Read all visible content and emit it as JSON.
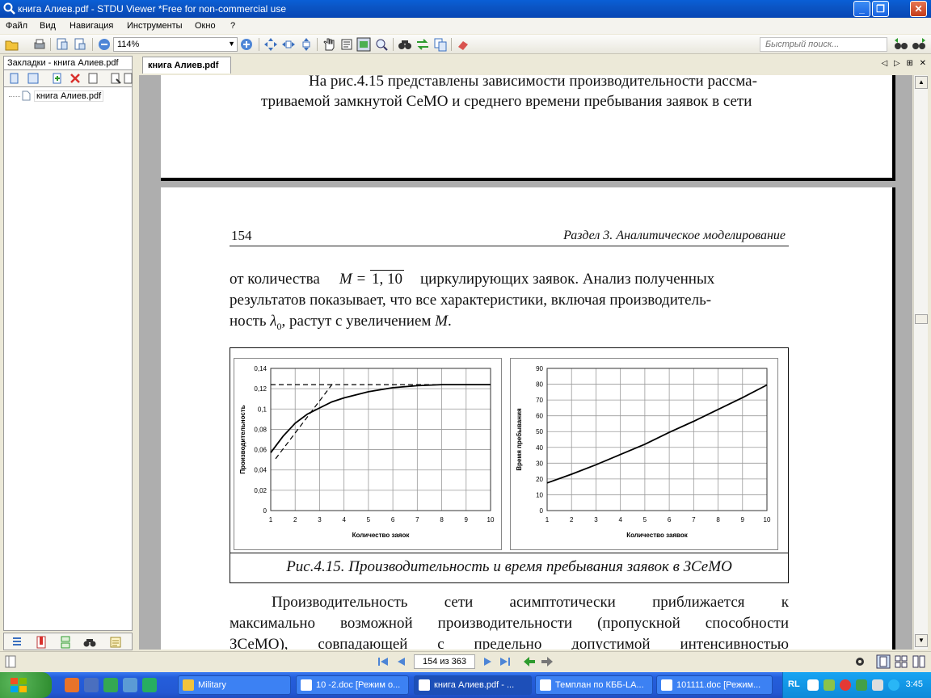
{
  "window": {
    "title": "книга Алиев.pdf - STDU Viewer *Free for non-commercial use",
    "min": "_",
    "max": "❐",
    "close": "✕"
  },
  "menu": [
    "Файл",
    "Вид",
    "Навигация",
    "Инструменты",
    "Окно",
    "?"
  ],
  "toolbar": {
    "zoom": "114%",
    "quick_search_placeholder": "Быстрый поиск..."
  },
  "bookmarks": {
    "tab_label": "Закладки - книга Алиев.pdf",
    "tree": [
      {
        "label": "книга Алиев.pdf"
      }
    ]
  },
  "doc_tab": {
    "label": "книга Алиев.pdf",
    "controls": [
      "◁",
      "▷",
      "⊞",
      "✕"
    ]
  },
  "page_prev": {
    "line1": "На рис.4.15 представлены зависимости производительности рассма-",
    "line2": "триваемой замкнутой СеМО и среднего времени пребывания заявок в сети"
  },
  "page": {
    "number": "154",
    "section": "Раздел 3.",
    "section_title": " Аналитическое моделирование",
    "para1": {
      "l1a": "от количества",
      "m_eq": "M = ",
      "range": "1, 10",
      "l1b": "циркулирующих заявок. Анализ полученных",
      "l2": "результатов показывает, что все характеристики, включая производитель-",
      "l3a": "ность ",
      "lambda": "λ",
      "sub0": "0",
      "l3b": ", растут с увеличением ",
      "M": "M",
      "dot": "."
    },
    "caption": "Рис.4.15. Производительность и время пребывания заявок в ЗСеМО",
    "para2": {
      "l1": "Производительность   сети   асимптотически   приближается   к",
      "l2": "максимально возможной производительности (пропускной способности",
      "l3": "ЗСеМО),   совпадающей   с   предельно   допустимой   интенсивностью"
    }
  },
  "chart_data": [
    {
      "type": "line",
      "xlabel": "Количество заяок",
      "ylabel": "Производительность",
      "xlim": [
        1,
        10
      ],
      "ylim": [
        0,
        0.14
      ],
      "x_ticks": [
        "1",
        "2",
        "3",
        "4",
        "5",
        "6",
        "7",
        "8",
        "9",
        "10"
      ],
      "y_ticks": [
        "0",
        "0,02",
        "0,04",
        "0,06",
        "0,08",
        "0,1",
        "0,12",
        "0,14"
      ],
      "grid": true,
      "series": [
        {
          "style": "solid",
          "x": [
            1,
            1.5,
            2,
            2.5,
            3,
            3.5,
            4,
            5,
            6,
            7,
            8,
            9,
            10
          ],
          "y": [
            0.057,
            0.073,
            0.086,
            0.095,
            0.101,
            0.107,
            0.111,
            0.117,
            0.121,
            0.123,
            0.124,
            0.124,
            0.124
          ]
        },
        {
          "style": "dashed",
          "x": [
            1,
            10
          ],
          "y": [
            0.124,
            0.124
          ]
        },
        {
          "style": "dashed",
          "x": [
            1.2,
            3.6
          ],
          "y": [
            0.051,
            0.127
          ]
        }
      ]
    },
    {
      "type": "line",
      "xlabel": "Количество заявок",
      "ylabel": "Время пребывания",
      "xlim": [
        1,
        10
      ],
      "ylim": [
        0,
        90
      ],
      "x_ticks": [
        "1",
        "2",
        "3",
        "4",
        "5",
        "6",
        "7",
        "8",
        "9",
        "10"
      ],
      "y_ticks": [
        "0",
        "10",
        "20",
        "30",
        "40",
        "50",
        "60",
        "70",
        "80",
        "90"
      ],
      "grid": true,
      "series": [
        {
          "style": "solid",
          "x": [
            1,
            2,
            3,
            4,
            5,
            6,
            7,
            8,
            9,
            10
          ],
          "y": [
            17.5,
            23,
            29,
            35.5,
            42,
            49.5,
            56.5,
            64,
            71.5,
            79.5
          ]
        }
      ]
    }
  ],
  "statusbar": {
    "page_indicator": "154 из 363"
  },
  "taskbar": {
    "tasks": [
      "Military",
      "10 -2.doc [Режим о...",
      "книга Алиев.pdf - ...",
      "Темплан по КББ-LA...",
      "101111.doc [Режим..."
    ],
    "lang": "RL",
    "clock": "3:45"
  }
}
